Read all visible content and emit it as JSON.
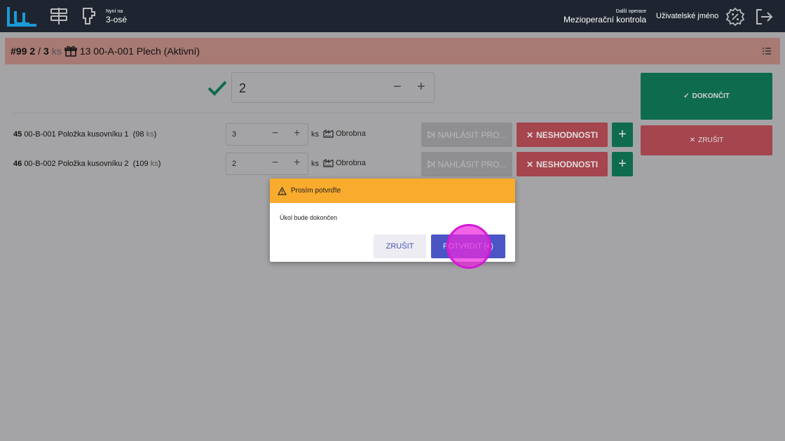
{
  "topbar": {
    "now_label": "Nyní na",
    "now_value": "3-osé",
    "next_label": "Další operace",
    "next_value": "Mezioperační kontrola",
    "username": "Uživatelské jméno"
  },
  "order": {
    "number": "#99",
    "count_done": "2",
    "count_sep": "/",
    "count_total": "3",
    "unit": "ks",
    "product": "13 00-A-001 Plech (Aktivní)"
  },
  "main_quantity": {
    "value": "2",
    "minus": "−",
    "plus": "+"
  },
  "items": [
    {
      "position": "45",
      "code_name": "00-B-001 Položka kusovníku 1",
      "stock_open": "(98",
      "stock_unit": "ks",
      "stock_close": ")",
      "qty": "3",
      "unit": "ks",
      "place": "Obrobna",
      "report_label": "NAHLÁSIT PRO...",
      "nonconf_label": "NESHODNOSTI",
      "minus": "−",
      "plus": "+",
      "add": "+"
    },
    {
      "position": "46",
      "code_name": "00-B-002 Položka kusovníku 2",
      "stock_open": "(109",
      "stock_unit": "ks",
      "stock_close": ")",
      "qty": "2",
      "unit": "ks",
      "place": "Obrobna",
      "report_label": "NAHLÁSIT PRO...",
      "nonconf_label": "NESHODNOSTI",
      "minus": "−",
      "plus": "+",
      "add": "+"
    }
  ],
  "actions": {
    "finish_label": "DOKONČIT",
    "cancel_label": "ZRUŠIT"
  },
  "dialog": {
    "title": "Prosím potvrďte",
    "message": "Úkol bude dokončen",
    "cancel_label": "ZRUŠIT",
    "confirm_label": "POTVRDIT (4)"
  },
  "colors": {
    "topbar": "#1f2530",
    "accent_green": "#0f6b4e",
    "accent_red": "#a5454e",
    "dialog_header": "#f8ab2c",
    "confirm": "#4b56c4",
    "logo": "#1a9ad6"
  },
  "icons": {
    "logo": "brand-logo",
    "routing": "signpost-icon",
    "tool": "machine-icon",
    "settings": "percent-badge-icon",
    "logout": "logout-icon"
  }
}
